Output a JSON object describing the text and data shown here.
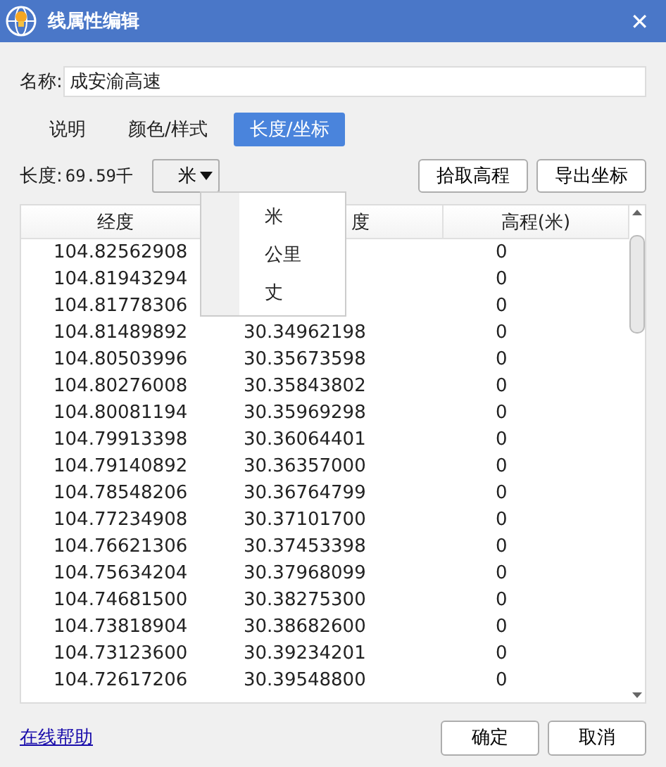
{
  "window": {
    "title": "线属性编辑",
    "close": "✕"
  },
  "name_field": {
    "label": "名称:",
    "value": "成安渝高速"
  },
  "tabs": [
    {
      "label": "说明",
      "selected": false
    },
    {
      "label": "颜色/样式",
      "selected": false
    },
    {
      "label": "长度/坐标",
      "selected": true
    }
  ],
  "length": {
    "label": "长度:",
    "value": "69.59千"
  },
  "unit_select": {
    "value": "米",
    "open": true,
    "options": [
      "米",
      "公里",
      "丈"
    ]
  },
  "actions": [
    "拾取高程",
    "导出坐标"
  ],
  "table": {
    "columns": [
      "经度",
      "度",
      "高程(米)"
    ],
    "rows": [
      {
        "longitude": "104.82562908",
        "elevation": "0"
      },
      {
        "longitude": "104.81943294",
        "elevation": "0"
      },
      {
        "longitude": "104.81778306",
        "elevation": "0"
      },
      {
        "longitude": "104.81489892",
        "column_2": "30.34962198",
        "elevation": "0"
      },
      {
        "longitude": "104.80503996",
        "column_2": "30.35673598",
        "elevation": "0"
      },
      {
        "longitude": "104.80276008",
        "column_2": "30.35843802",
        "elevation": "0"
      },
      {
        "longitude": "104.80081194",
        "column_2": "30.35969298",
        "elevation": "0"
      },
      {
        "longitude": "104.79913398",
        "column_2": "30.36064401",
        "elevation": "0"
      },
      {
        "longitude": "104.79140892",
        "column_2": "30.36357000",
        "elevation": "0"
      },
      {
        "longitude": "104.78548206",
        "column_2": "30.36764799",
        "elevation": "0"
      },
      {
        "longitude": "104.77234908",
        "column_2": "30.37101700",
        "elevation": "0"
      },
      {
        "longitude": "104.76621306",
        "column_2": "30.37453398",
        "elevation": "0"
      },
      {
        "longitude": "104.75634204",
        "column_2": "30.37968099",
        "elevation": "0"
      },
      {
        "longitude": "104.74681500",
        "column_2": "30.38275300",
        "elevation": "0"
      },
      {
        "longitude": "104.73818904",
        "column_2": "30.38682600",
        "elevation": "0"
      },
      {
        "longitude": "104.73123600",
        "column_2": "30.39234201",
        "elevation": "0"
      },
      {
        "longitude": "104.72617206",
        "column_2": "30.39548800",
        "elevation": "0"
      }
    ]
  },
  "help_link": "在线帮助",
  "dialog_buttons": [
    "确定",
    "取消"
  ]
}
